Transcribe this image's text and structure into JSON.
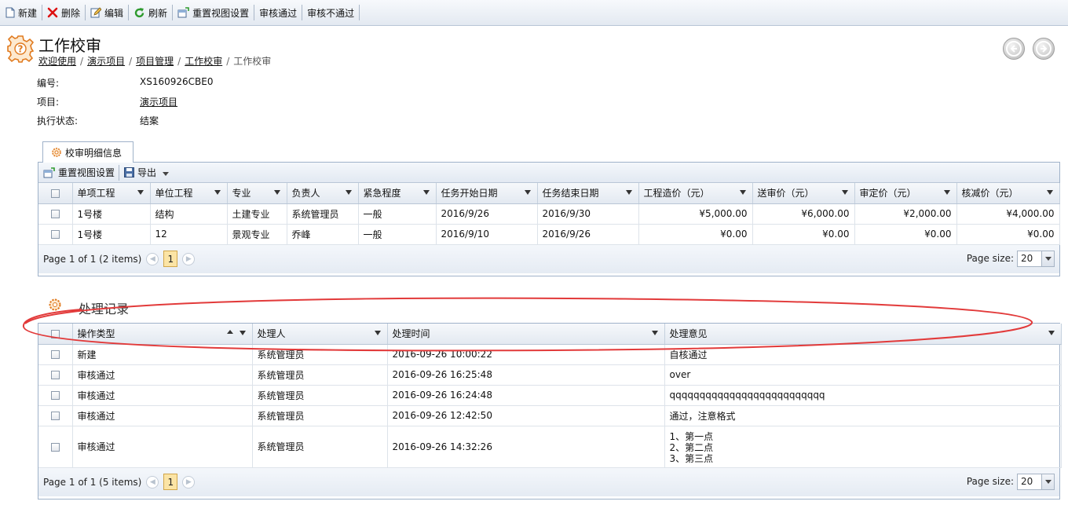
{
  "toolbar": {
    "items": [
      {
        "label": "新建",
        "icon": "new-document-icon"
      },
      {
        "label": "删除",
        "icon": "delete-x-icon"
      },
      {
        "label": "编辑",
        "icon": "edit-icon"
      },
      {
        "label": "刷新",
        "icon": "refresh-icon"
      },
      {
        "label": "重置视图设置",
        "icon": "reset-view-icon"
      },
      {
        "label": "审核通过"
      },
      {
        "label": "审核不通过"
      }
    ]
  },
  "header": {
    "title": "工作校审",
    "breadcrumb": [
      "欢迎使用",
      "演示项目",
      "项目管理",
      "工作校审",
      "工作校审"
    ]
  },
  "info": {
    "fields": [
      {
        "label": "编号:",
        "value": "XS160926CBE0"
      },
      {
        "label": "项目:",
        "value": "演示项目"
      },
      {
        "label": "执行状态:",
        "value": "结案"
      }
    ]
  },
  "detail": {
    "tab_label": "校审明细信息",
    "toolbar": {
      "reset_label": "重置视图设置",
      "export_label": "导出"
    },
    "columns": [
      "单项工程",
      "单位工程",
      "专业",
      "负责人",
      "紧急程度",
      "任务开始日期",
      "任务结束日期",
      "工程造价（元）",
      "送审价（元）",
      "审定价（元）",
      "核减价（元）"
    ],
    "rows": [
      [
        "1号楼",
        "结构",
        "土建专业",
        "系统管理员",
        "一般",
        "2016/9/26",
        "2016/9/30",
        "¥5,000.00",
        "¥6,000.00",
        "¥2,000.00",
        "¥4,000.00"
      ],
      [
        "1号楼",
        "12",
        "景观专业",
        "乔峰",
        "一般",
        "2016/9/10",
        "2016/9/26",
        "¥0.00",
        "¥0.00",
        "¥0.00",
        "¥0.00"
      ]
    ],
    "pager": {
      "summary": "Page 1 of 1 (2 items)",
      "current": "1",
      "size_label": "Page size:",
      "size": "20"
    }
  },
  "records": {
    "title": "处理记录",
    "columns": [
      "操作类型",
      "处理人",
      "处理时间",
      "处理意见"
    ],
    "rows": [
      [
        "新建",
        "系统管理员",
        "2016-09-26 10:00:22",
        "自核通过"
      ],
      [
        "审核通过",
        "系统管理员",
        "2016-09-26 16:25:48",
        "over"
      ],
      [
        "审核通过",
        "系统管理员",
        "2016-09-26 16:24:48",
        "qqqqqqqqqqqqqqqqqqqqqqqqqq"
      ],
      [
        "审核通过",
        "系统管理员",
        "2016-09-26 12:42:50",
        "通过，注意格式"
      ]
    ],
    "multiline_row": {
      "type": "审核通过",
      "user": "系统管理员",
      "time": "2016-09-26 14:32:26",
      "comment_lines": [
        "1、第一点",
        "2、第二点",
        "3、第三点"
      ]
    },
    "pager": {
      "summary": "Page 1 of 1 (5 items)",
      "current": "1",
      "size_label": "Page size:",
      "size": "20"
    }
  },
  "colors": {
    "accent": "#e07a1f",
    "annotation": "#e23a3a",
    "grid_border": "#9fb2c9"
  }
}
